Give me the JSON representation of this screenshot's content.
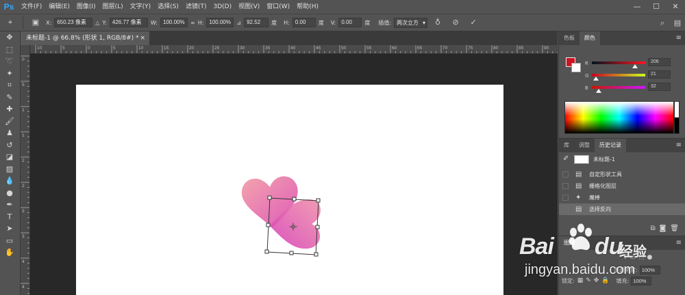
{
  "app": {
    "logo": "Ps"
  },
  "menu": [
    "文件(F)",
    "编辑(E)",
    "图像(I)",
    "图层(L)",
    "文字(Y)",
    "选择(S)",
    "滤镜(T)",
    "3D(D)",
    "视图(V)",
    "窗口(W)",
    "帮助(H)"
  ],
  "window_controls": [
    "—",
    "☐",
    "✕"
  ],
  "options": {
    "x_label": "X:",
    "x_value": "650.23 像素",
    "y_label": "Y:",
    "y_value": "426.77 像素",
    "w_label": "W:",
    "w_value": "100.00%",
    "h_label": "H:",
    "h_value": "100.00%",
    "angle_value": "92.52",
    "angle_unit": "度",
    "hskew_label": "H:",
    "hskew_value": "0.00",
    "hskew_unit": "度",
    "vskew_label": "V:",
    "vskew_value": "0.00",
    "vskew_unit": "度",
    "interp_label": "插值:",
    "interp_value": "两次立方"
  },
  "document": {
    "tab_title": "未标题-1 @ 66.8% (形状 1, RGB/8#) *",
    "close": "×"
  },
  "rulers": {
    "h_ticks": [
      "10",
      "5",
      "0",
      "5",
      "10",
      "15",
      "20",
      "25",
      "30",
      "35",
      "40",
      "45",
      "50",
      "55",
      "60",
      "65",
      "70",
      "75",
      "80",
      "85",
      "90"
    ],
    "v_ticks": [
      "0",
      "5",
      "1",
      "1",
      "2",
      "2",
      "3",
      "3",
      "4",
      "4"
    ]
  },
  "color_panel": {
    "tabs": [
      "色板",
      "颜色"
    ],
    "active_tab": "颜色",
    "foreground": "#cd1522",
    "background": "#ffffff",
    "sliders": [
      {
        "label": "R",
        "value": "206",
        "level": 0.81
      },
      {
        "label": "G",
        "value": "21",
        "level": 0.08
      },
      {
        "label": "B",
        "value": "32",
        "level": 0.13
      }
    ]
  },
  "history_panel": {
    "tabs": [
      "库",
      "调整",
      "历史记录"
    ],
    "active_tab": "历史记录",
    "snapshot": "未标题-1",
    "items": [
      {
        "label": "自定形状工具",
        "icon": "document-icon",
        "selected": false
      },
      {
        "label": "栅格化图层",
        "icon": "document-icon",
        "selected": false
      },
      {
        "label": "魔棒",
        "icon": "magic-wand-icon",
        "selected": false
      },
      {
        "label": "选择反向",
        "icon": "document-icon",
        "selected": true
      }
    ]
  },
  "layers_panel": {
    "title": "图层",
    "opacity_label": "不透明度:",
    "opacity_value": "100%",
    "lock_label": "锁定:",
    "fill_label": "填充:",
    "fill_value": "100%"
  },
  "watermark": {
    "brand_a": "Bai",
    "brand_b": "du",
    "brand_cn": "经验",
    "url": "jingyan.baidu.com"
  },
  "shape_colors": {
    "light": "#ef8fa8",
    "dark": "#d93fb8"
  }
}
